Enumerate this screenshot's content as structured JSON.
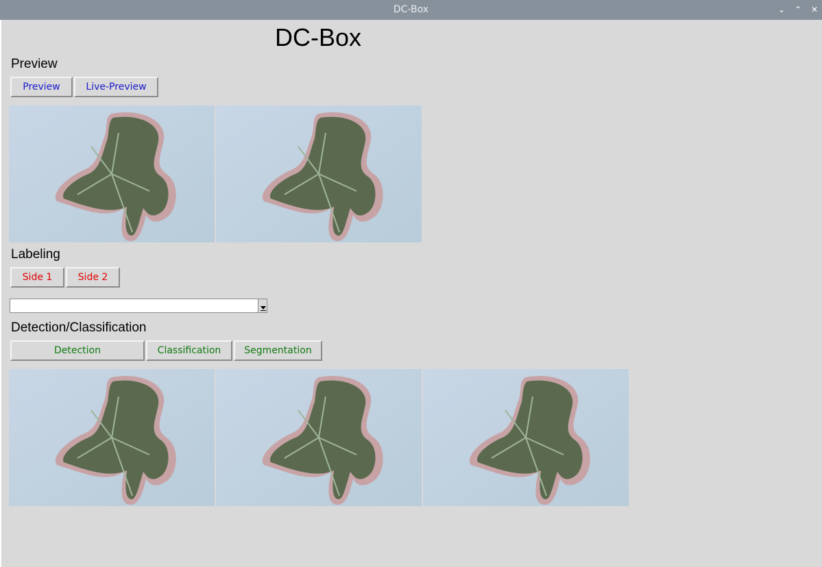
{
  "window": {
    "title": "DC-Box"
  },
  "app": {
    "title": "DC-Box"
  },
  "preview": {
    "label": "Preview",
    "buttons": [
      "Preview",
      "Live-Preview"
    ]
  },
  "labeling": {
    "label": "Labeling",
    "buttons": [
      "Side 1",
      "Side 2"
    ],
    "dropdown_value": ""
  },
  "detection": {
    "label": "Detection/Classification",
    "buttons": [
      "Detection",
      "Classification",
      "Segmentation"
    ]
  },
  "colors": {
    "preview_buttons": "#1a1acc",
    "labeling_buttons": "#e00000",
    "detection_buttons": "#117a11",
    "titlebar": "#87919b",
    "background": "#d9d9d9"
  },
  "icons": {
    "minimize": "chevron-down-icon",
    "maximize": "chevron-up-icon",
    "close": "close-icon",
    "leaf": "leaf-photo"
  }
}
